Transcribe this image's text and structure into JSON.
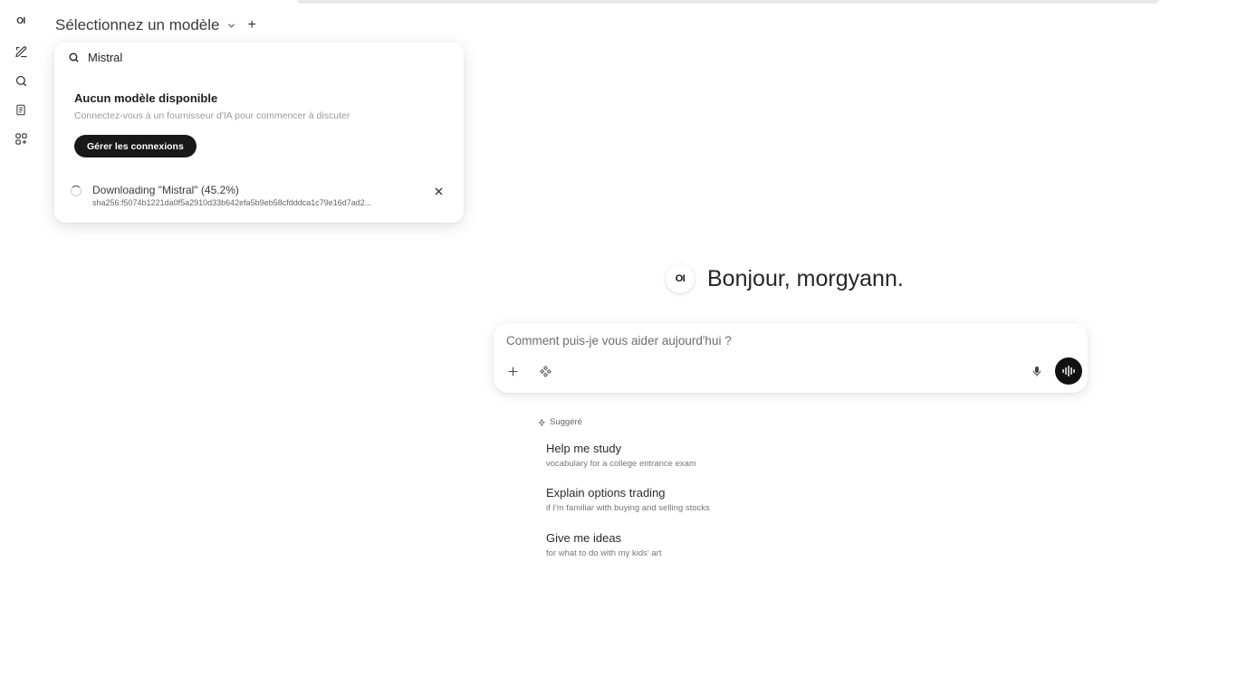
{
  "sidebar": {
    "logo": "OI",
    "items": [
      {
        "name": "new-chat",
        "icon": "pencil-icon"
      },
      {
        "name": "search",
        "icon": "search-icon"
      },
      {
        "name": "notes",
        "icon": "notes-icon"
      },
      {
        "name": "workspace",
        "icon": "grid-icon"
      }
    ]
  },
  "model_selector": {
    "label": "Sélectionnez un modèle",
    "add": "+"
  },
  "dropdown": {
    "search_value": "Mistral",
    "empty_title": "Aucun modèle disponible",
    "empty_subtitle": "Connectez-vous à un fournisseur d'IA pour commencer à discuter",
    "manage_button": "Gérer les connexions",
    "download": {
      "title": "Downloading \"Mistral\" (45.2%)",
      "progress_percent": 45.2,
      "hash": "sha256:f5074b1221da0f5a2910d33b642efa5b9eb58cfdddca1c79e16d7ad2..."
    }
  },
  "greeting": {
    "logo": "OI",
    "text": "Bonjour, morgyann."
  },
  "chat": {
    "placeholder": "Comment puis-je vous aider aujourd'hui ?"
  },
  "suggestions": {
    "header": "Suggéré",
    "items": [
      {
        "title": "Help me study",
        "subtitle": "vocabulary for a college entrance exam"
      },
      {
        "title": "Explain options trading",
        "subtitle": "if I'm familiar with buying and selling stocks"
      },
      {
        "title": "Give me ideas",
        "subtitle": "for what to do with my kids' art"
      }
    ]
  },
  "colors": {
    "primary_button": "#181818",
    "background": "#ffffff",
    "muted_text": "#9a9a9a"
  }
}
